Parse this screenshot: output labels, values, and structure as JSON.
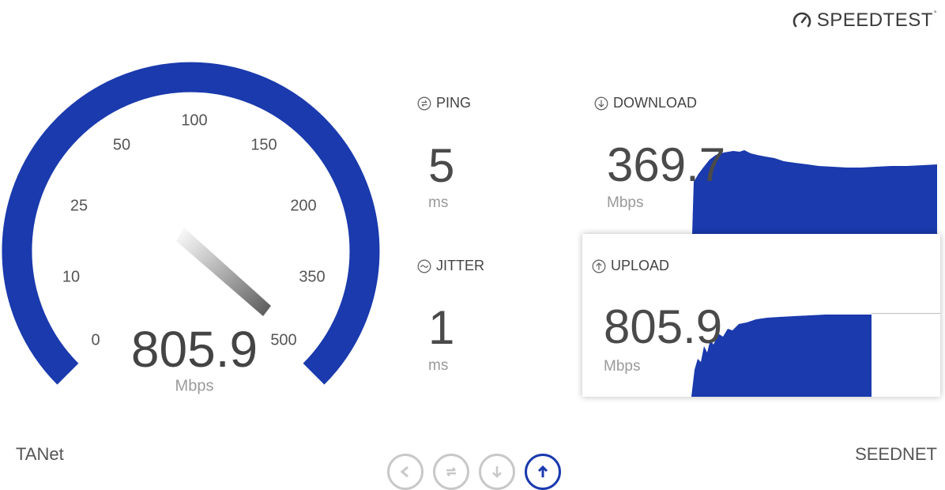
{
  "brand": {
    "label": "SPEEDTEST",
    "tm": "°",
    "icon": "gauge-logo-icon"
  },
  "gauge": {
    "value": "805.9",
    "unit": "Mbps",
    "ticks": [
      "0",
      "10",
      "25",
      "50",
      "100",
      "150",
      "200",
      "350",
      "500"
    ],
    "arc_color": "#1a3aad"
  },
  "ping": {
    "label": "PING",
    "value": "5",
    "unit": "ms",
    "icon": "ping-icon"
  },
  "jitter": {
    "label": "JITTER",
    "value": "1",
    "unit": "ms",
    "icon": "jitter-icon"
  },
  "download": {
    "label": "DOWNLOAD",
    "value": "369.7",
    "unit": "Mbps",
    "icon": "download-icon"
  },
  "upload": {
    "label": "UPLOAD",
    "value": "805.9",
    "unit": "Mbps",
    "icon": "upload-icon"
  },
  "isp": "TANet",
  "server": "SEEDNET",
  "nav": [
    {
      "icon": "back-icon",
      "active": false
    },
    {
      "icon": "ping-icon",
      "active": false
    },
    {
      "icon": "download-icon",
      "active": false
    },
    {
      "icon": "upload-icon",
      "active": true
    }
  ],
  "colors": {
    "accent": "#1a3aad",
    "text": "#4a4a4a",
    "muted": "#9a9a9a"
  }
}
